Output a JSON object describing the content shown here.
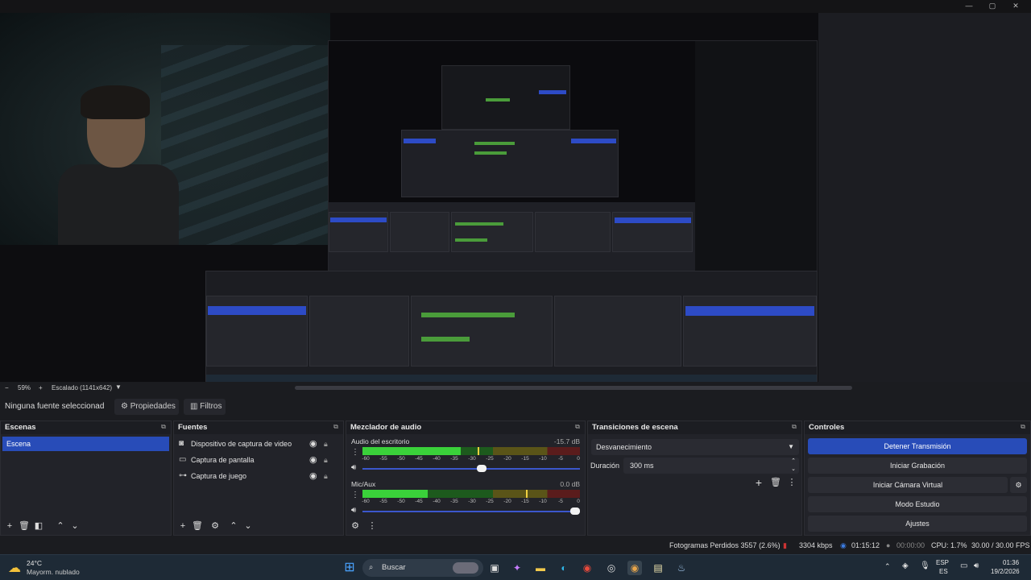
{
  "preview": {
    "zoom_minus": "−",
    "zoom_level": "59%",
    "zoom_plus": "+",
    "scale_label": "Escalado (1141x642)"
  },
  "source_toolbar": {
    "no_source_selected": "Ninguna fuente seleccionad",
    "properties_label": "Propiedades",
    "filters_label": "Filtros"
  },
  "scenes": {
    "title": "Escenas",
    "items": [
      "Escena"
    ]
  },
  "sources": {
    "title": "Fuentes",
    "items": [
      {
        "label": "Dispositivo de captura de video",
        "icon": "camera-icon"
      },
      {
        "label": "Captura de pantalla",
        "icon": "monitor-icon"
      },
      {
        "label": "Captura de juego",
        "icon": "gamepad-icon"
      }
    ]
  },
  "mixer": {
    "title": "Mezclador de audio",
    "channels": [
      {
        "name": "Audio del escritorio",
        "db": "-15.7 dB",
        "level": 0.45,
        "peak": 0.53,
        "volume": 0.55
      },
      {
        "name": "Mic/Aux",
        "db": "0.0 dB",
        "level": 0.3,
        "peak": 0.75,
        "volume": 1.0
      }
    ],
    "ticks": [
      "-60",
      "-55",
      "-50",
      "-45",
      "-40",
      "-35",
      "-30",
      "-25",
      "-20",
      "-15",
      "-10",
      "-5",
      "0"
    ]
  },
  "transitions": {
    "title": "Transiciones de escena",
    "selected": "Desvanecimiento",
    "duration_label": "Duración",
    "duration_value": "300 ms"
  },
  "controls": {
    "title": "Controles",
    "stop_stream": "Detener Transmisión",
    "start_recording": "Iniciar Grabación",
    "start_virtual_cam": "Iniciar Cámara Virtual",
    "studio_mode": "Modo Estudio",
    "settings": "Ajustes"
  },
  "status": {
    "dropped_frames": "Fotogramas Perdidos 3557 (2.6%)",
    "bitrate": "3304 kbps",
    "stream_time": "01:15:12",
    "record_time": "00:00:00",
    "cpu": "CPU: 1.7%",
    "fps": "30.00 / 30.00 FPS"
  },
  "taskbar": {
    "weather_temp": "24°C",
    "weather_desc": "Mayorm. nublado",
    "search_placeholder": "Buscar",
    "lang_top": "ESP",
    "lang_bottom": "ES",
    "time": "01:36",
    "date": "19/2/2026"
  },
  "colors": {
    "accent": "#284cb8",
    "meter_green": "#3ad13a",
    "meter_yellow": "#5a5418",
    "meter_red": "#5a1c1c"
  }
}
